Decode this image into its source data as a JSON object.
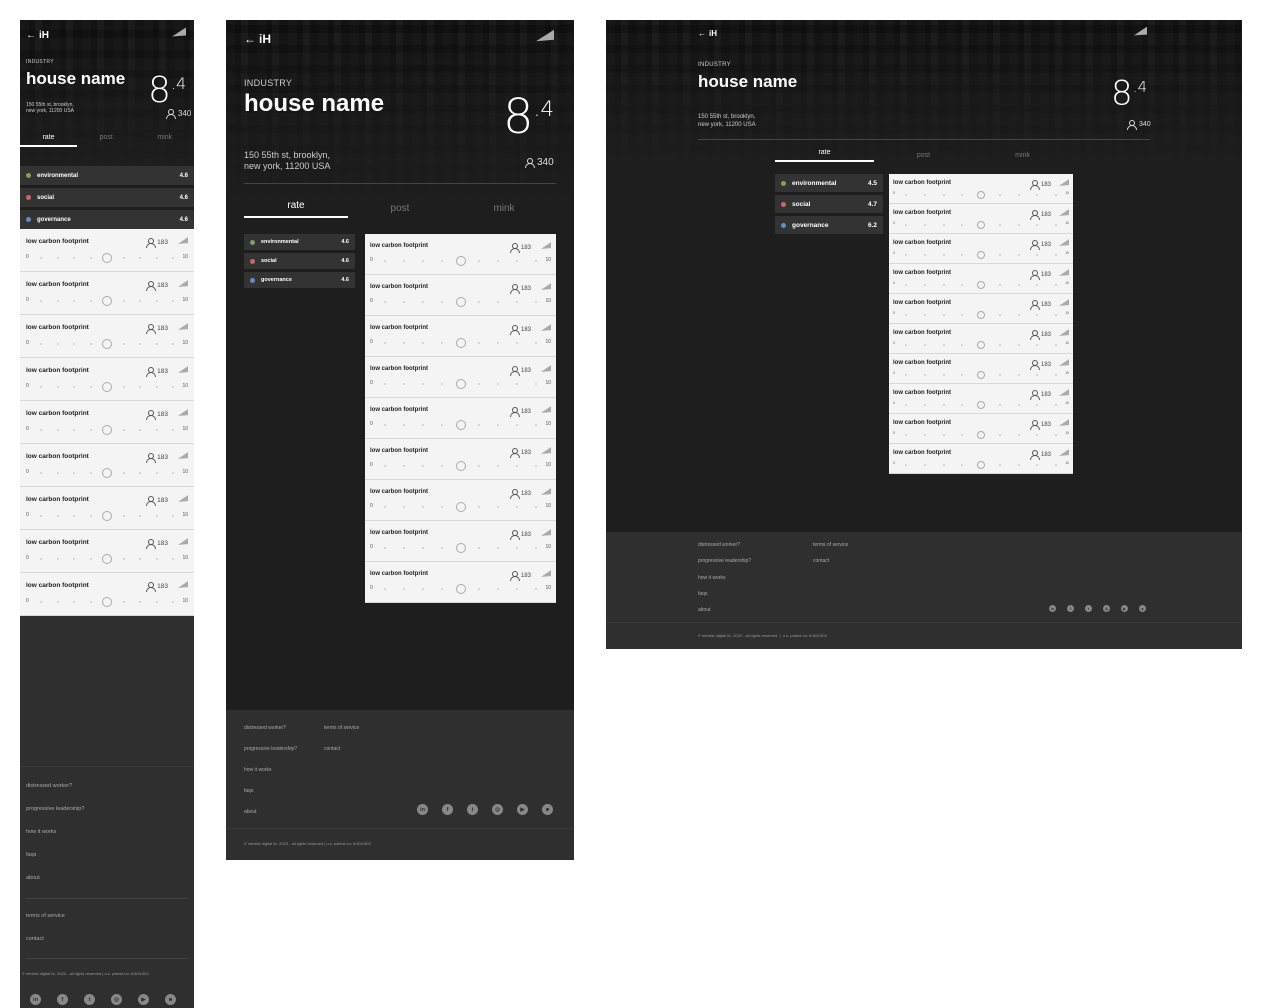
{
  "brand": "iH",
  "back_arrow": "←",
  "industry": "INDUSTRY",
  "house_name": "house name",
  "score_int": "8",
  "score_dec": ".4",
  "address_line1": "150 55th st, brooklyn,",
  "address_line2": "new york, 11200 USA",
  "users_count": "340",
  "tabs": [
    "rate",
    "post",
    "mink"
  ],
  "categories_mobile": [
    {
      "label": "environmental",
      "value": "4.6",
      "color": "#7da35c"
    },
    {
      "label": "social",
      "value": "4.6",
      "color": "#c8666c"
    },
    {
      "label": "governance",
      "value": "4.6",
      "color": "#5a8fc8"
    }
  ],
  "categories_desktop": [
    {
      "label": "environmental",
      "value": "4.5",
      "color": "#7da35c"
    },
    {
      "label": "social",
      "value": "4.7",
      "color": "#c8666c"
    },
    {
      "label": "governance",
      "value": "6.2",
      "color": "#5a8fc8"
    }
  ],
  "card": {
    "title": "low carbon footprint",
    "count": "183",
    "min": "0",
    "max": "10",
    "level": 0.5
  },
  "footer": {
    "links_a": [
      "distressed worker?",
      "progressive leadership?",
      "how it works",
      "faqs",
      "about"
    ],
    "links_b": [
      "terms of service",
      "contact"
    ],
    "copyright": "© minkist digital llc, 2020 - all rights reserved",
    "separator": "|",
    "patent": "u.s. patent no: 8,804,502",
    "social": [
      "in",
      "f",
      "t",
      "◎",
      "▶",
      "☻"
    ]
  }
}
